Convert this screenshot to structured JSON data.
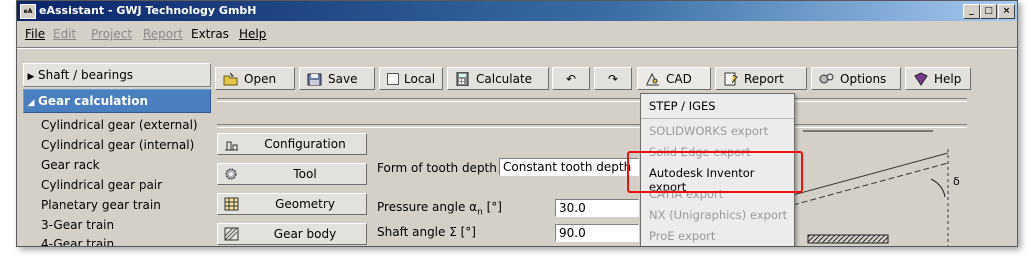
{
  "window": {
    "title": "eAssistant - GWJ Technology GmbH",
    "app_icon_text": "eA",
    "controls": [
      "_",
      "□",
      "×"
    ]
  },
  "menubar": {
    "items": [
      {
        "label": "File",
        "enabled": true
      },
      {
        "label": "Edit",
        "enabled": false
      },
      {
        "label": "Project",
        "enabled": false
      },
      {
        "label": "Report",
        "enabled": false
      },
      {
        "label": "Extras",
        "enabled": true
      },
      {
        "label": "Help",
        "enabled": true
      }
    ]
  },
  "sidebar": {
    "sections": [
      {
        "label": "Shaft / bearings",
        "expanded": false
      },
      {
        "label": "Gear calculation",
        "expanded": true
      }
    ],
    "items": [
      "Cylindrical gear (external)",
      "Cylindrical gear (internal)",
      "Gear rack",
      "Cylindrical gear pair",
      "Planetary gear train",
      "3-Gear train",
      "4-Gear train"
    ]
  },
  "toolbar": {
    "open": "Open",
    "save": "Save",
    "local": "Local",
    "calculate": "Calculate",
    "undo_icon": "undo-icon",
    "redo_icon": "redo-icon",
    "cad": "CAD",
    "report": "Report",
    "options": "Options",
    "help": "Help"
  },
  "side_buttons": {
    "configuration": "Configuration",
    "tool": "Tool",
    "geometry": "Geometry",
    "gear_body": "Gear body"
  },
  "form": {
    "tooth_depth_label": "Form of tooth depth",
    "tooth_depth_value": "Constant tooth depth",
    "pressure_angle_label": "Pressure angle α",
    "pressure_angle_sub": "n",
    "pressure_angle_unit": " [°]",
    "pressure_angle_value": "30.0",
    "shaft_angle_label": "Shaft angle Σ [°]",
    "shaft_angle_value": "90.0"
  },
  "cad_menu": {
    "items": [
      {
        "label": "STEP / IGES",
        "enabled": true
      },
      {
        "label": "SOLIDWORKS export",
        "enabled": false
      },
      {
        "label": "Solid Edge export",
        "enabled": false
      },
      {
        "label": "Autodesk Inventor export",
        "enabled": true
      },
      {
        "label": "CATIA export",
        "enabled": false
      },
      {
        "label": "NX (Unigraphics) export",
        "enabled": false
      },
      {
        "label": "ProE export",
        "enabled": false
      }
    ]
  },
  "diagram": {
    "angle_symbol": "δ"
  },
  "colors": {
    "title_bar_start": "#0a246a",
    "active_section": "#4a7fbf",
    "highlight": "#ee1111"
  }
}
